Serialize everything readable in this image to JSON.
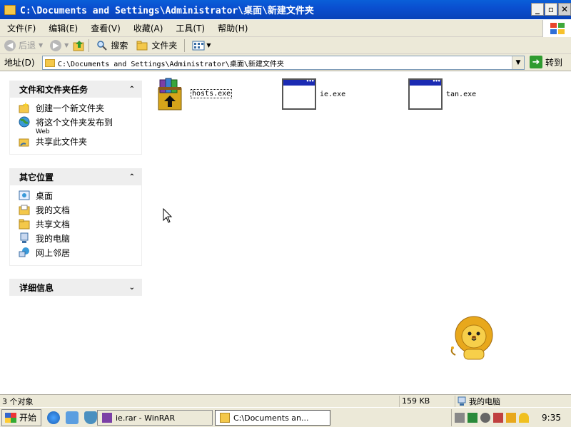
{
  "window": {
    "title": "C:\\Documents and Settings\\Administrator\\桌面\\新建文件夹",
    "min_label": "_",
    "max_label": "▫",
    "close_label": "✕"
  },
  "menu": [
    "文件(F)",
    "编辑(E)",
    "查看(V)",
    "收藏(A)",
    "工具(T)",
    "帮助(H)"
  ],
  "toolbar": {
    "back_label": "后退",
    "search_label": "搜索",
    "folders_label": "文件夹"
  },
  "address": {
    "label": "地址(D)",
    "value": "C:\\Documents and Settings\\Administrator\\桌面\\新建文件夹",
    "go_label": "转到"
  },
  "tasks_panel": {
    "title": "文件和文件夹任务",
    "items": [
      {
        "label": "创建一个新文件夹"
      },
      {
        "label": "将这个文件夹发布到",
        "sub": "Web"
      },
      {
        "label": "共享此文件夹"
      }
    ]
  },
  "places_panel": {
    "title": "其它位置",
    "items": [
      {
        "label": "桌面"
      },
      {
        "label": "我的文档"
      },
      {
        "label": "共享文档"
      },
      {
        "label": "我的电脑"
      },
      {
        "label": "网上邻居"
      }
    ]
  },
  "details_panel": {
    "title": "详细信息"
  },
  "files": [
    {
      "name": "hosts.exe",
      "icon": "winrar-archive-icon"
    },
    {
      "name": "ie.exe",
      "icon": "exe-window-icon"
    },
    {
      "name": "tan.exe",
      "icon": "exe-window-icon"
    }
  ],
  "status": {
    "objects": "3 个对象",
    "size": "159 KB",
    "location": "我的电脑"
  },
  "taskbar": {
    "start_label": "开始",
    "tasks": [
      "ie.rar - WinRAR",
      "C:\\Documents an..."
    ],
    "clock": "9:35"
  }
}
